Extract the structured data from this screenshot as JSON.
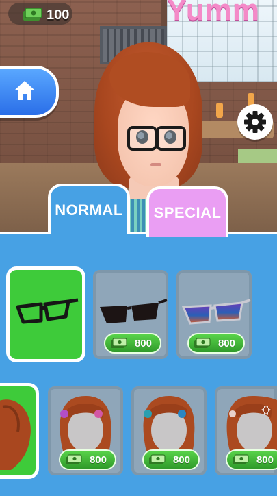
{
  "hud": {
    "money": "100",
    "money_icon": "cash-icon"
  },
  "scene": {
    "sign_text": "Yumm"
  },
  "buttons": {
    "home_icon": "home-icon",
    "settings_icon": "gear-icon"
  },
  "tabs": [
    {
      "label": "NORMAL",
      "active": true
    },
    {
      "label": "SPECIAL",
      "active": false
    }
  ],
  "items_row1": [
    {
      "name": "black-glasses",
      "price": "",
      "selected": true
    },
    {
      "name": "dark-sunglasses",
      "price": "800",
      "selected": false
    },
    {
      "name": "gradient-sunglasses",
      "price": "800",
      "selected": false
    }
  ],
  "items_row2": [
    {
      "name": "brown-hair",
      "price": "",
      "selected": true
    },
    {
      "name": "hair-pink-clip",
      "price": "800",
      "selected": false
    },
    {
      "name": "hair-teal-clip",
      "price": "800",
      "selected": false
    },
    {
      "name": "hair-bow",
      "price": "800",
      "selected": false
    }
  ],
  "colors": {
    "panel": "#47a1e4",
    "selected": "#3ecb3a",
    "special_tab": "#ea9ef3",
    "price": "#3fb433"
  }
}
